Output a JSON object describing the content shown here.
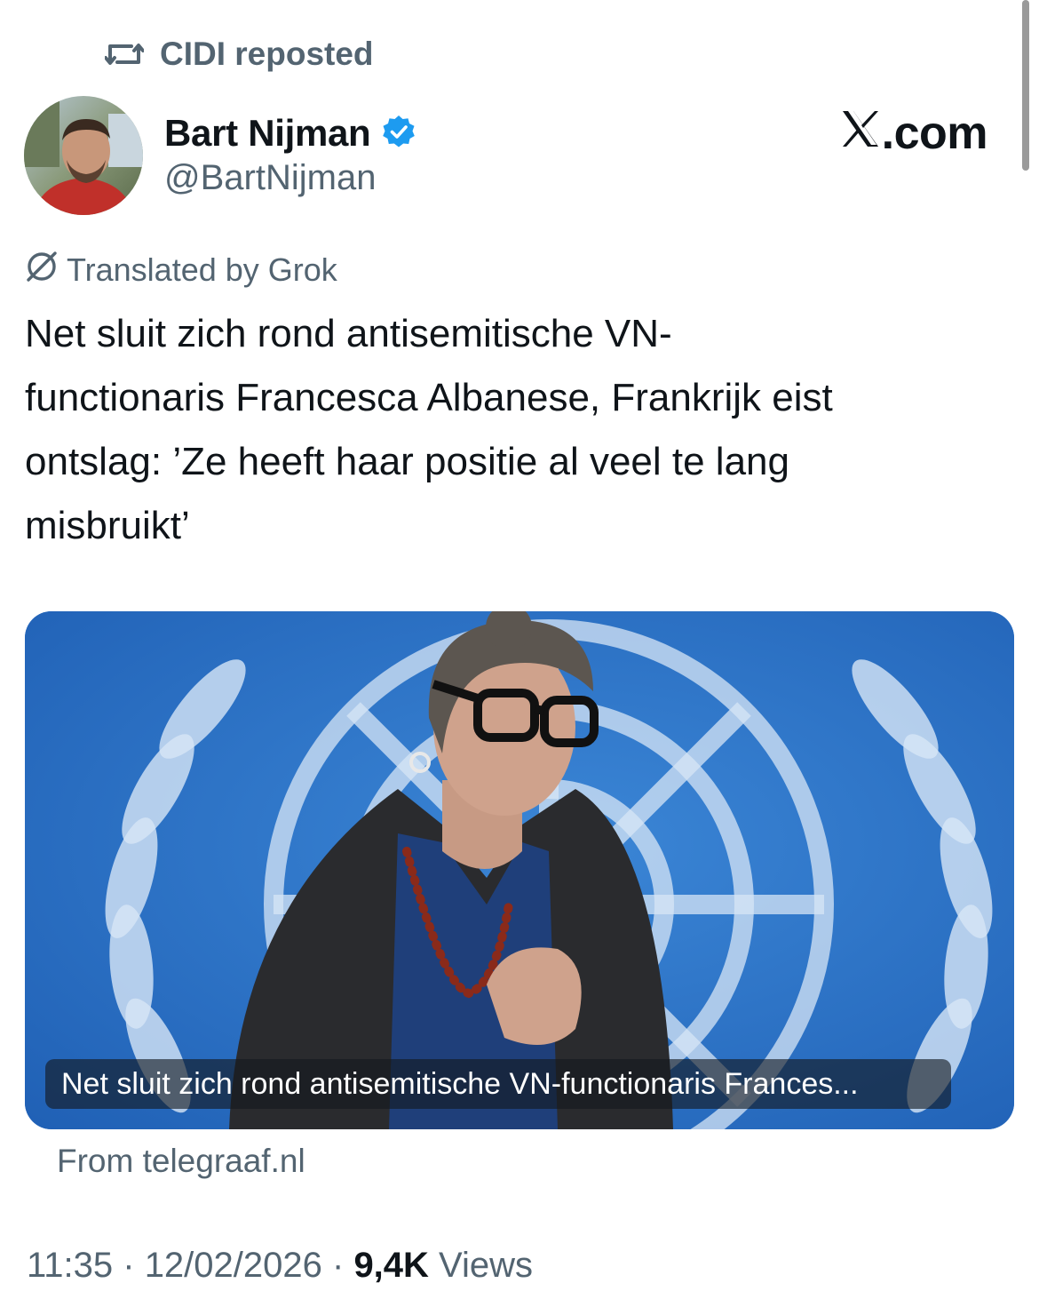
{
  "repost": {
    "icon": "repost-icon",
    "text": "CIDI reposted"
  },
  "author": {
    "display_name": "Bart Nijman",
    "handle": "@BartNijman",
    "verified_icon": "verified-badge-icon",
    "verified_color": "#1d9bf0"
  },
  "brand": {
    "logo_icon": "x-logo-icon",
    "domain_suffix": ".com"
  },
  "translation": {
    "icon": "grok-icon",
    "label": "Translated by Grok"
  },
  "tweet": {
    "text_lines": [
      "Net sluit zich rond antisemitische VN-",
      "functionaris Francesca Albanese, Frankrijk eist",
      "ontslag: ’Ze heeft haar positie al veel te lang",
      "misbruikt’"
    ]
  },
  "media": {
    "caption": "Net sluit zich rond antisemitische VN-functionaris Frances...",
    "background_color": "#2a6fc4"
  },
  "card": {
    "source": "From telegraaf.nl"
  },
  "meta": {
    "time": "11:35",
    "separator": " · ",
    "date": "12/02/2026",
    "views_count": "9,4K",
    "views_label": " Views"
  },
  "colors": {
    "text_primary": "#0f1419",
    "text_secondary": "#536471"
  }
}
